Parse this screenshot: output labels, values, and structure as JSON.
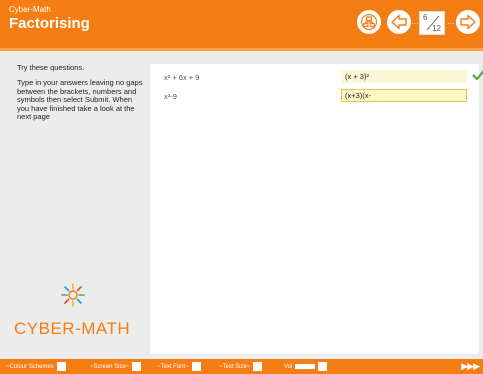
{
  "app": {
    "name": "Cyber-Math",
    "title": "Factorising"
  },
  "nav": {
    "home_icon": "sitemap-icon",
    "back_icon": "arrow-left-icon",
    "forward_icon": "arrow-right-icon",
    "dots": "····",
    "page_current": "6",
    "page_total": "12"
  },
  "left": {
    "heading": "Try these questions.",
    "instructions": "Type in your answers leaving no gaps between the brackets, numbers and symbols then select Submit. When you have finished take a look at the next page",
    "logo_text": "CYBER-MATH"
  },
  "questions": [
    {
      "expression": "x² + 6x + 9",
      "answer": "(x + 3)²",
      "status": "correct"
    },
    {
      "expression": "x²-9",
      "answer": "(x+3)(x-",
      "status": "editing"
    }
  ],
  "footer": {
    "colour_schemes": "~Colour Schemes",
    "screen_size": "~Screen Size~",
    "text_font": "~Text Font~",
    "text_size": "~Text Size~",
    "vol": "Vol",
    "next_arrows": "▶▶▶"
  },
  "colors": {
    "accent": "#f47d14",
    "correct": "#4caf3a"
  }
}
